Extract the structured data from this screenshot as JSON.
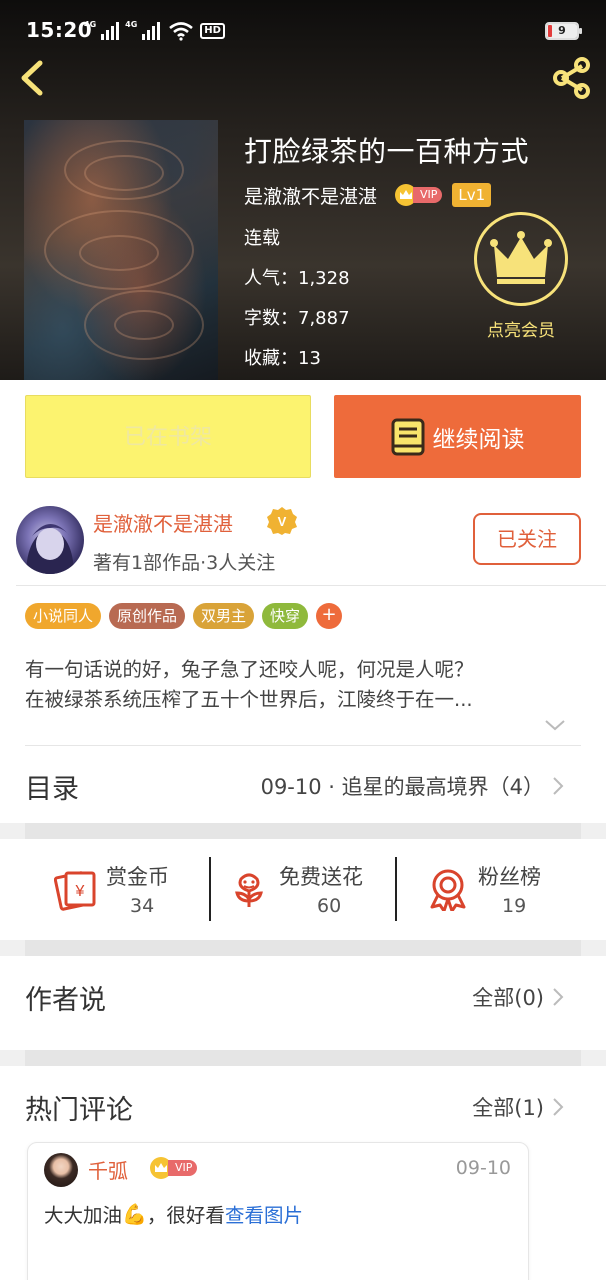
{
  "status_bar": {
    "time": "15:20",
    "signal_tag_1": "4G",
    "signal_tag_2": "4G",
    "hd_label": "HD",
    "battery_level": "9"
  },
  "book": {
    "title": "打脸绿茶的一百种方式",
    "author": "是澈澈不是湛湛",
    "vip_label": "VIP",
    "level_label": "Lv1",
    "status": "连载",
    "popularity": "人气：1,328",
    "word_count": "字数：7,887",
    "favorites": "收藏：13"
  },
  "member": {
    "label": "点亮会员"
  },
  "actions": {
    "shelf_label": "已在书架",
    "read_label": "继续阅读"
  },
  "author_card": {
    "name": "是澈澈不是湛湛",
    "sub": "著有1部作品·3人关注",
    "follow_label": "已关注"
  },
  "tags": [
    {
      "label": "小说同人",
      "color": "#f0a72d"
    },
    {
      "label": "原创作品",
      "color": "#b86a52"
    },
    {
      "label": "双男主",
      "color": "#d9a338"
    },
    {
      "label": "快穿",
      "color": "#8fb93c"
    }
  ],
  "tag_add_label": "+",
  "description": {
    "line1": "有一句话说的好，兔子急了还咬人呢，何况是人呢？",
    "line2": "在被绿茶系统压榨了五十个世界后，江陵终于在一..."
  },
  "catalog": {
    "title": "目录",
    "latest": "09-10 · 追星的最高境界（4）"
  },
  "stats": {
    "reward_label": "赏金币",
    "reward_value": "34",
    "flower_label": "免费送花",
    "flower_value": "60",
    "fans_label": "粉丝榜",
    "fans_value": "19"
  },
  "author_says": {
    "title": "作者说",
    "all_label": "全部(0)"
  },
  "hot_comments": {
    "title": "热门评论",
    "all_label": "全部(1)",
    "comment": {
      "user": "千弧",
      "vip_label": "VIP",
      "date": "09-10",
      "text": "大大加油",
      "emoji": "💪",
      "text_after": "，很好看",
      "link": "查看图片"
    }
  },
  "colors": {
    "accent_orange": "#ee6b3b",
    "author_red": "#e0603b",
    "shelf_yellow": "#fcf36f",
    "member_gold": "#f7e27a",
    "link_blue": "#2b6fd6"
  }
}
